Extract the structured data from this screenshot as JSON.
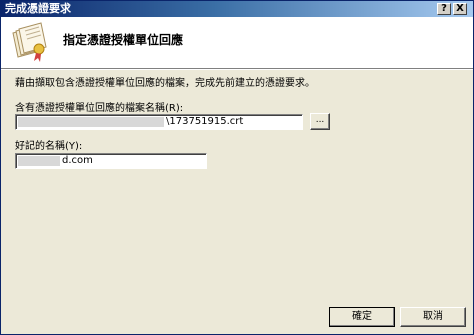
{
  "window": {
    "title": "完成憑證要求",
    "help_button": "?",
    "close_button": "X"
  },
  "header": {
    "icon": "certificate-stack-icon",
    "title": "指定憑證授權單位回應"
  },
  "description": "藉由擷取包含憑證授權單位回應的檔案，完成先前建立的憑證要求。",
  "file_field": {
    "label": "含有憑證授權單位回應的檔案名稱(R):",
    "value": "\\173751915.crt",
    "browse_label": "..."
  },
  "name_field": {
    "label": "好記的名稱(Y):",
    "value": "d.com"
  },
  "buttons": {
    "ok": "確定",
    "cancel": "取消"
  }
}
